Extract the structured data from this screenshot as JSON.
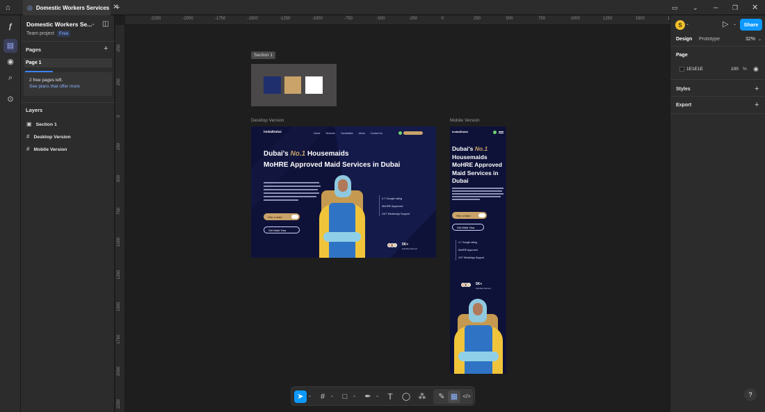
{
  "tabs": {
    "active_title": "Domestic Workers Services"
  },
  "file": {
    "name": "Domestic Workers Se...",
    "project": "Team project",
    "plan_badge": "Free"
  },
  "pages": {
    "heading": "Pages",
    "items": [
      "Page 1"
    ],
    "notice_line1": "2 free pages left.",
    "notice_link": "See plans that offer more"
  },
  "layers": {
    "heading": "Layers",
    "items": [
      "Section 1",
      "Desktop Version",
      "Mobile Version"
    ]
  },
  "rulers": {
    "top": [
      "-2250",
      "-2000",
      "-1750",
      "-1500",
      "-1250",
      "-1000",
      "-750",
      "-500",
      "-250",
      "0",
      "250",
      "500",
      "750",
      "1000",
      "1250",
      "1500",
      "1750"
    ],
    "left": [
      "-250",
      "250",
      "0",
      "250",
      "500",
      "750",
      "1000",
      "1250",
      "1500",
      "1750",
      "2000",
      "2250"
    ]
  },
  "canvas": {
    "section_label": "Section 1",
    "desktop_label": "Desktop Version",
    "mobile_label": "Mobile Version",
    "swatches": [
      "#1f2f6e",
      "#c9a36a",
      "#ffffff"
    ],
    "desktop": {
      "logo": "imdadDubai",
      "nav": [
        "Home",
        "Services",
        "Candidates",
        "About",
        "Contact Us"
      ],
      "headline_pre": "Dubai's",
      "headline_accent": "No.1",
      "headline_post": "Housemaids",
      "headline_line2": "MoHRE Approved Maid Services in Dubai",
      "cta1": "Hire a maid",
      "cta2": "Get Maid Visa",
      "features": [
        "4.7 Google rating",
        "MoHRE Approved",
        "24/7 WhatsApp Support"
      ],
      "stat_value": "5K+",
      "stat_label": "Families Served"
    },
    "mobile": {
      "logo": "imdadDubai",
      "headline_pre": "Dubai's",
      "headline_accent": "No.1",
      "headline_rest": [
        "Housemaids",
        "MoHRE Approved",
        "Maid Services in",
        "Dubai"
      ],
      "cta1": "Hire a Maid",
      "cta2": "Get Maid Visa",
      "features": [
        "4.7 Google rating",
        "MoHRE Approved",
        "24/7 WhatsApp Support"
      ],
      "stat_value": "5K+",
      "stat_label": "Families Served"
    }
  },
  "right": {
    "avatar_letter": "S",
    "share_label": "Share",
    "tab_design": "Design",
    "tab_prototype": "Prototype",
    "zoom": "32%",
    "page_heading": "Page",
    "page_color": "1E1E1E",
    "page_opacity": "100",
    "percent": "%",
    "styles_heading": "Styles",
    "export_heading": "Export"
  },
  "colors": {
    "accent": "#0d99ff",
    "canvas_bg": "#1e1e1e",
    "design_bg": "#0f1238",
    "gold": "#c9a36a"
  },
  "help": "?"
}
